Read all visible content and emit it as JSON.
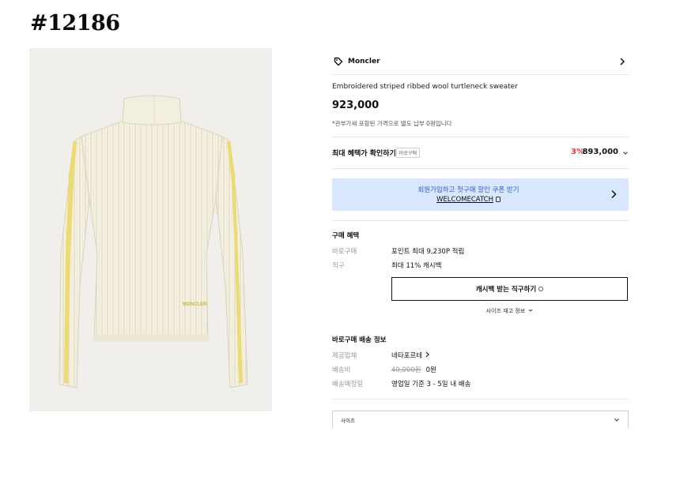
{
  "watermark_id": "#12186",
  "brand": {
    "name": "Moncler"
  },
  "product": {
    "title": "Embroidered striped ribbed wool turtleneck sweater",
    "price": "923,000",
    "tax_note": "*관부가세 포함된 가격으로 별도 납부 0원입니다",
    "image_logo_text": "MONCLER"
  },
  "benefit": {
    "label": "최대 혜택가 확인하기",
    "chip": "바로구매",
    "discount_pct": "3%",
    "discount_price": "893,000"
  },
  "coupon": {
    "message": "회원가입하고 첫구매 할인 쿠폰 받기",
    "code": "WELCOMECATCH"
  },
  "purchase_benefits": {
    "title": "구매 혜택",
    "rows": [
      {
        "key": "바로구매",
        "value": "포인트 최대 9,230P 적립"
      },
      {
        "key": "직구",
        "value": "최대 11% 캐시백"
      }
    ],
    "cashback_button": "캐시백 받는 직구하기",
    "stock_link": "사이즈 재고 정보"
  },
  "shipping": {
    "title": "바로구매 배송 정보",
    "vendor_key": "제공업체",
    "vendor_value": "네타포르테",
    "fee_key": "배송비",
    "fee_original": "40,000원",
    "fee_value": "0원",
    "eta_key": "배송예정일",
    "eta_value": "영업일 기준 3 - 5일 내 배송"
  },
  "size_select": {
    "label": "사이즈"
  },
  "colors": {
    "accent_red": "#e8383d",
    "banner_bg": "#d8e7fd",
    "banner_text": "#2f5fd0"
  }
}
